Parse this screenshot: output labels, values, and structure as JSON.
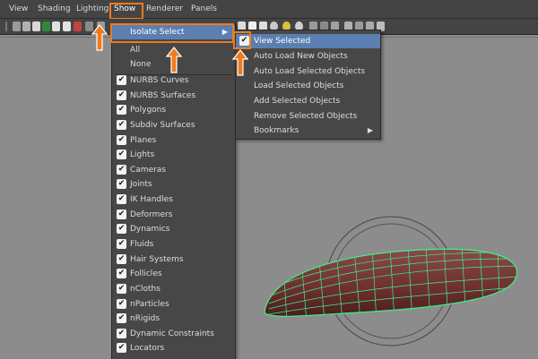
{
  "menubar": {
    "items": [
      {
        "label": "View"
      },
      {
        "label": "Shading"
      },
      {
        "label": "Lighting"
      },
      {
        "label": "Show"
      },
      {
        "label": "Renderer"
      },
      {
        "label": "Panels"
      }
    ]
  },
  "show_menu": {
    "isolate_select_label": "Isolate Select",
    "all_label": "All",
    "none_label": "None",
    "items": [
      {
        "label": "NURBS Curves",
        "checked": true
      },
      {
        "label": "NURBS Surfaces",
        "checked": true
      },
      {
        "label": "Polygons",
        "checked": true
      },
      {
        "label": "Subdiv Surfaces",
        "checked": true
      },
      {
        "label": "Planes",
        "checked": true
      },
      {
        "label": "Lights",
        "checked": true
      },
      {
        "label": "Cameras",
        "checked": true
      },
      {
        "label": "Joints",
        "checked": true
      },
      {
        "label": "IK Handles",
        "checked": true
      },
      {
        "label": "Deformers",
        "checked": true
      },
      {
        "label": "Dynamics",
        "checked": true
      },
      {
        "label": "Fluids",
        "checked": true
      },
      {
        "label": "Hair Systems",
        "checked": true
      },
      {
        "label": "Follicles",
        "checked": true
      },
      {
        "label": "nCloths",
        "checked": true
      },
      {
        "label": "nParticles",
        "checked": true
      },
      {
        "label": "nRigids",
        "checked": true
      },
      {
        "label": "Dynamic Constraints",
        "checked": true
      },
      {
        "label": "Locators",
        "checked": true
      }
    ]
  },
  "isolate_submenu": {
    "items": [
      {
        "label": "View Selected",
        "checked": true
      },
      {
        "label": "Auto Load New Objects",
        "checked": false
      },
      {
        "label": "Auto Load Selected Objects",
        "checked": false
      },
      {
        "label": "Load Selected Objects",
        "checked": false
      },
      {
        "label": "Add Selected Objects",
        "checked": false
      },
      {
        "label": "Remove Selected Objects",
        "checked": false
      },
      {
        "label": "Bookmarks",
        "checked": false
      }
    ]
  },
  "colors": {
    "highlight": "#f07a1e",
    "menu_bg": "#474747",
    "selected_bg": "#5b7fb0",
    "mesh": "#7a3a3a",
    "wire": "#3ef08a"
  },
  "icons": [
    "submenu-arrow-icon",
    "checkmark-icon",
    "pointer-arrow-icon",
    "sphere-icon"
  ]
}
